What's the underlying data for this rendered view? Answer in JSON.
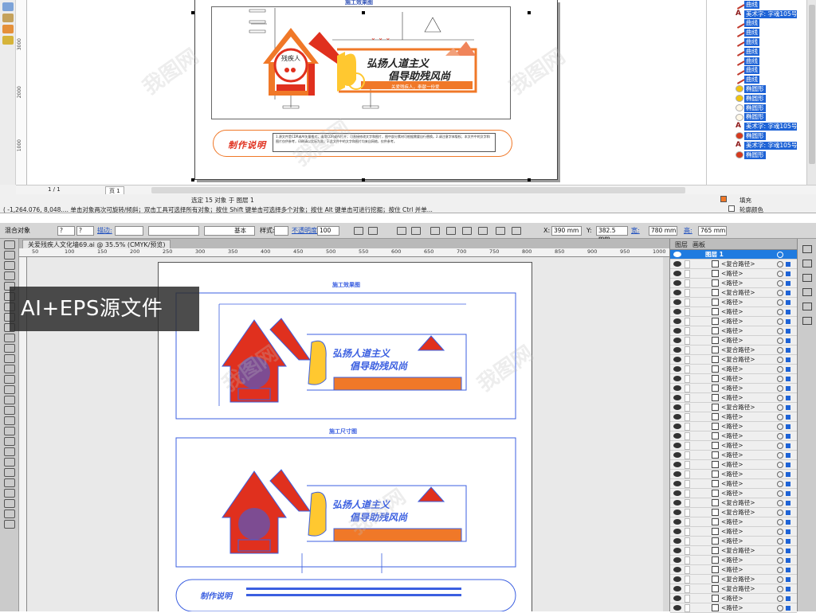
{
  "corel": {
    "status_selected": "选定 15 对象 于 图层 1",
    "status_hint": "( -1,264.076, 8,048.... 单击对象两次可旋转/倾斜；双击工具可选择所有对象；按住 Shift 键单击可选择多个对象；按住 Alt 键单击可进行挖掘；按住 Ctrl 并单...",
    "page_nav": "1 / 1",
    "page_tab": "页 1",
    "fill_label": "填充",
    "outline_label": "轮廓颜色",
    "ruler_marks": [
      "3000",
      "2000",
      "1000"
    ],
    "design_title": "施工效果图",
    "slogan_line1": "弘扬人道主义",
    "slogan_line2": "倡导助残风尚",
    "subline": "关爱残疾人，奉献一份爱",
    "house_label": "残疾人",
    "note_label": "制作说明",
    "note_text": "1.源文件是CDR或AI矢量格式，请用CDR或AI打开，可直接修改文字和图片，图中部分素材可根据需要自行替换。2.请注意字体版权，本文件中的文字和图片仅供参考，印刷请以实际为准。3.此文件中的文字和图片均来自网络，仅供参考。",
    "objects": [
      {
        "icon": "curve",
        "label": "曲线"
      },
      {
        "icon": "text",
        "label": "美术字: 字魂105号"
      },
      {
        "icon": "curve",
        "label": "曲线"
      },
      {
        "icon": "curve",
        "label": "曲线"
      },
      {
        "icon": "curve",
        "label": "曲线"
      },
      {
        "icon": "curve",
        "label": "曲线"
      },
      {
        "icon": "curve",
        "label": "曲线"
      },
      {
        "icon": "curve",
        "label": "曲线"
      },
      {
        "icon": "curve",
        "label": "曲线"
      },
      {
        "icon": "ellipse-y",
        "label": "椭圆形"
      },
      {
        "icon": "ellipse-y",
        "label": "椭圆形"
      },
      {
        "icon": "ellipse-w",
        "label": "椭圆形"
      },
      {
        "icon": "ellipse-w",
        "label": "椭圆形"
      },
      {
        "icon": "text",
        "label": "美术字: 字魂105号"
      },
      {
        "icon": "ellipse-r",
        "label": "椭圆形"
      },
      {
        "icon": "text",
        "label": "美术字: 字魂105号"
      },
      {
        "icon": "ellipse-r",
        "label": "椭圆形"
      }
    ]
  },
  "ai": {
    "ctrl_object": "混合对象",
    "ctrl_stroke_label": "描边:",
    "ctrl_basic": "基本",
    "ctrl_style": "样式:",
    "ctrl_opacity_label": "不透明度:",
    "ctrl_opacity": "100",
    "ctrl_x_label": "X:",
    "ctrl_x": "390 mm",
    "ctrl_y_label": "Y:",
    "ctrl_y": "382.5 mm",
    "ctrl_w_label": "宽:",
    "ctrl_w": "780 mm",
    "ctrl_h_label": "高:",
    "ctrl_h": "765 mm",
    "doc_tab": "关爱残疾人文化墙69.ai @ 35.5% (CMYK/预览)",
    "hruler": [
      "50",
      "100",
      "150",
      "200",
      "250",
      "300",
      "350",
      "400",
      "450",
      "500",
      "550",
      "600",
      "650",
      "700",
      "750",
      "800",
      "850",
      "900",
      "950",
      "1000"
    ],
    "panel_tab1": "图层",
    "panel_tab2": "画板",
    "layer_name": "图层 1",
    "layer_items": [
      "<复合路径>",
      "<路径>",
      "<路径>",
      "<复合路径>",
      "<路径>",
      "<路径>",
      "<路径>",
      "<路径>",
      "<路径>",
      "<复合路径>",
      "<复合路径>",
      "<路径>",
      "<路径>",
      "<路径>",
      "<路径>",
      "<复合路径>",
      "<路径>",
      "<路径>",
      "<路径>",
      "<路径>",
      "<路径>",
      "<路径>",
      "<路径>",
      "<路径>",
      "<路径>",
      "<复合路径>",
      "<复合路径>",
      "<路径>",
      "<路径>",
      "<路径>",
      "<复合路径>",
      "<路径>",
      "<路径>",
      "<复合路径>",
      "<复合路径>",
      "<路径>",
      "<路径>"
    ],
    "board1_title": "施工效果图",
    "board2_title": "施工尺寸图",
    "slogan_line1": "弘扬人道主义",
    "slogan_line2": "倡导助残风尚",
    "note_label": "制作说明"
  },
  "badge_text": "AI+EPS源文件",
  "watermark": "我图网",
  "colors": {
    "brand_red": "#e0301e",
    "brand_orange": "#f07828",
    "outline_blue": "#3b5fe0",
    "selection_blue": "#1e63d6"
  }
}
